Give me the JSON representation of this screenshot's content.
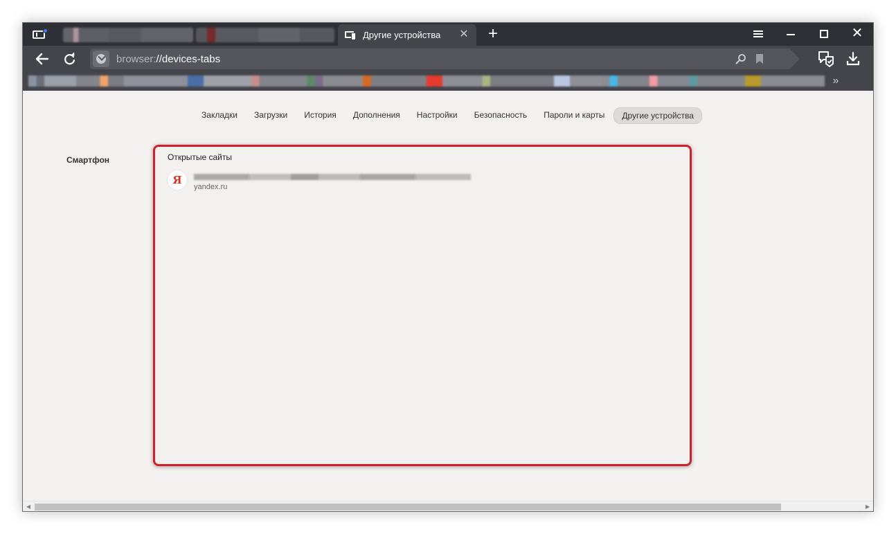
{
  "browser": {
    "active_tab": {
      "title": "Другие устройства",
      "close_glyph": "✕"
    },
    "new_tab_glyph": "+",
    "address_bar": {
      "scheme": "browser:",
      "path": "//devices-tabs"
    },
    "bookmarks_more_glyph": "»",
    "icons": [
      "tabs-toggle-icon",
      "devices-icon",
      "menu-icon",
      "minimize-icon",
      "maximize-icon",
      "close-icon",
      "back-arrow-icon",
      "reload-icon",
      "shield-icon",
      "search-icon",
      "bookmark-icon",
      "protect-icon",
      "download-icon"
    ]
  },
  "window_controls": {
    "close_glyph": "✕"
  },
  "settings_nav": {
    "items": [
      {
        "label": "Закладки"
      },
      {
        "label": "Загрузки"
      },
      {
        "label": "История"
      },
      {
        "label": "Дополнения"
      },
      {
        "label": "Настройки"
      },
      {
        "label": "Безопасность"
      },
      {
        "label": "Пароли и карты"
      },
      {
        "label": "Другие устройства",
        "active": true
      }
    ]
  },
  "devices": {
    "device_name": "Смартфон",
    "panel_title": "Открытые сайты",
    "sites": [
      {
        "favicon_letter": "Я",
        "domain": "yandex.ru"
      }
    ]
  },
  "colors": {
    "highlight": "#d21f2a",
    "chrome_dark": "#2f3035",
    "chrome_mid": "#44454b",
    "page_bg": "#f2f1ef",
    "notification_dot": "#2f7cf6",
    "yandex_red": "#e02b1a"
  },
  "scrollbar": {
    "left_arrow": "◀",
    "right_arrow": "▶"
  }
}
